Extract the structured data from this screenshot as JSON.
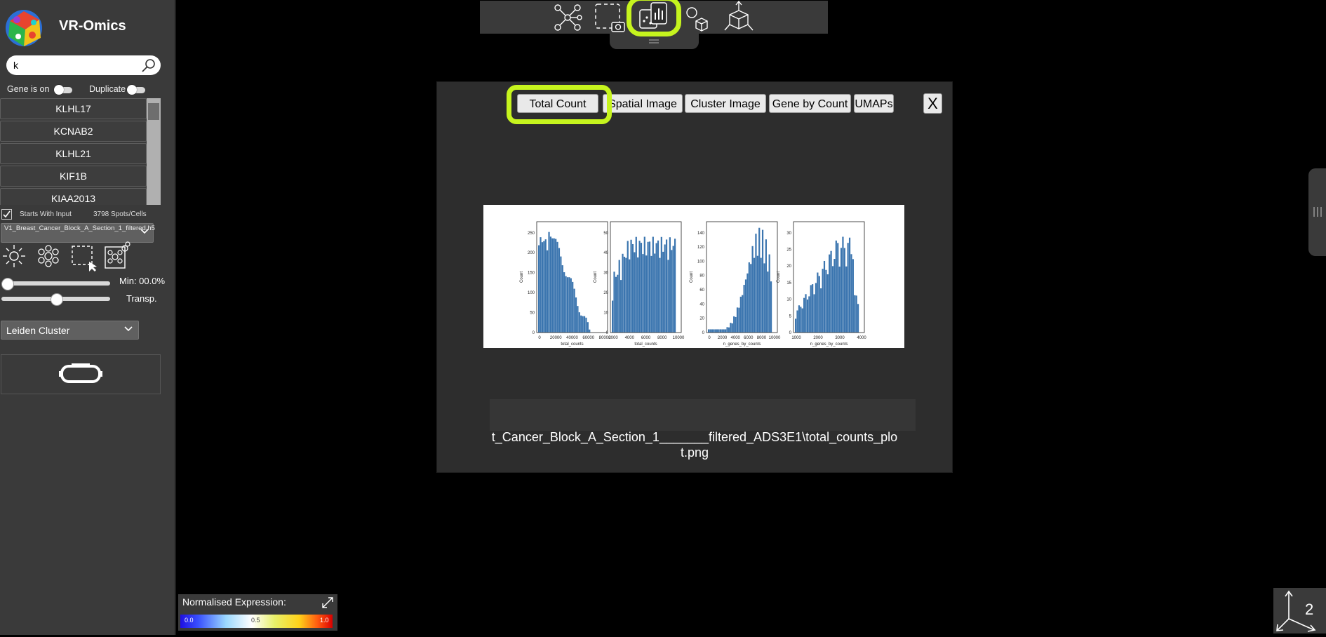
{
  "app": {
    "title": "VR-Omics"
  },
  "search": {
    "value": "k",
    "placeholder": ""
  },
  "toggles": {
    "gene_is_on": "Gene is on",
    "duplicate": "Duplicate"
  },
  "gene_list": [
    "KLHL17",
    "KCNAB2",
    "KLHL21",
    "KIF1B",
    "KIAA2013"
  ],
  "filters": {
    "starts_with_input": "Starts With Input",
    "spots_count": "3798 Spots/Cells",
    "starts_with_checked": true
  },
  "dataset": {
    "file": "V1_Breast_Cancer_Block_A_Section_1_filtered.h5"
  },
  "sliders": {
    "min_label": "Min: 00.0%",
    "min_value": 0.0,
    "transp_label": "Transp.",
    "transp_value": 0.5
  },
  "cluster": {
    "selected": "Leiden Cluster"
  },
  "toolbar": {
    "icons": [
      "network-icon",
      "screenshot-icon",
      "statistics-icon",
      "shapes-icon",
      "3d-axes-icon"
    ],
    "active": "statistics-icon"
  },
  "modal": {
    "tabs": [
      "Total Count",
      "Spatial Image",
      "Cluster Image",
      "Gene by Count",
      "UMAPs"
    ],
    "active_tab": "Total Count",
    "close_label": "X",
    "file_caption": "t_Cancer_Block_A_Section_1_______filtered_ADS3E1\\total_counts_plot.png"
  },
  "plot": {
    "panels": [
      {
        "xlabel": "total_counts",
        "ylabel": "Count",
        "xticks": [
          "0",
          "20000",
          "40000",
          "60000",
          "80000"
        ],
        "yticks": [
          "0",
          "50",
          "100",
          "150",
          "200",
          "250"
        ]
      },
      {
        "xlabel": "total_counts",
        "ylabel": "Count",
        "xticks": [
          "2000",
          "4000",
          "6000",
          "8000",
          "10000"
        ],
        "yticks": [
          "0",
          "10",
          "20",
          "30",
          "40",
          "50"
        ]
      },
      {
        "xlabel": "n_genes_by_counts",
        "ylabel": "Count",
        "xticks": [
          "0",
          "2000",
          "4000",
          "6000",
          "8000",
          "10000"
        ],
        "yticks": [
          "0",
          "20",
          "40",
          "60",
          "80",
          "100",
          "120",
          "140"
        ]
      },
      {
        "xlabel": "n_genes_by_counts",
        "ylabel": "Count",
        "xticks": [
          "1000",
          "2000",
          "3000",
          "4000"
        ],
        "yticks": [
          "0",
          "5",
          "10",
          "15",
          "20",
          "25",
          "30"
        ]
      }
    ]
  },
  "legend": {
    "title": "Normalised Expression:",
    "min": "0.0",
    "mid": "0.5",
    "max": "1.0"
  },
  "colors": {
    "highlight": "#c6f41e",
    "panel": "#3a3a3a",
    "modal": "#2d2d2d",
    "bar": "#3b75af"
  }
}
